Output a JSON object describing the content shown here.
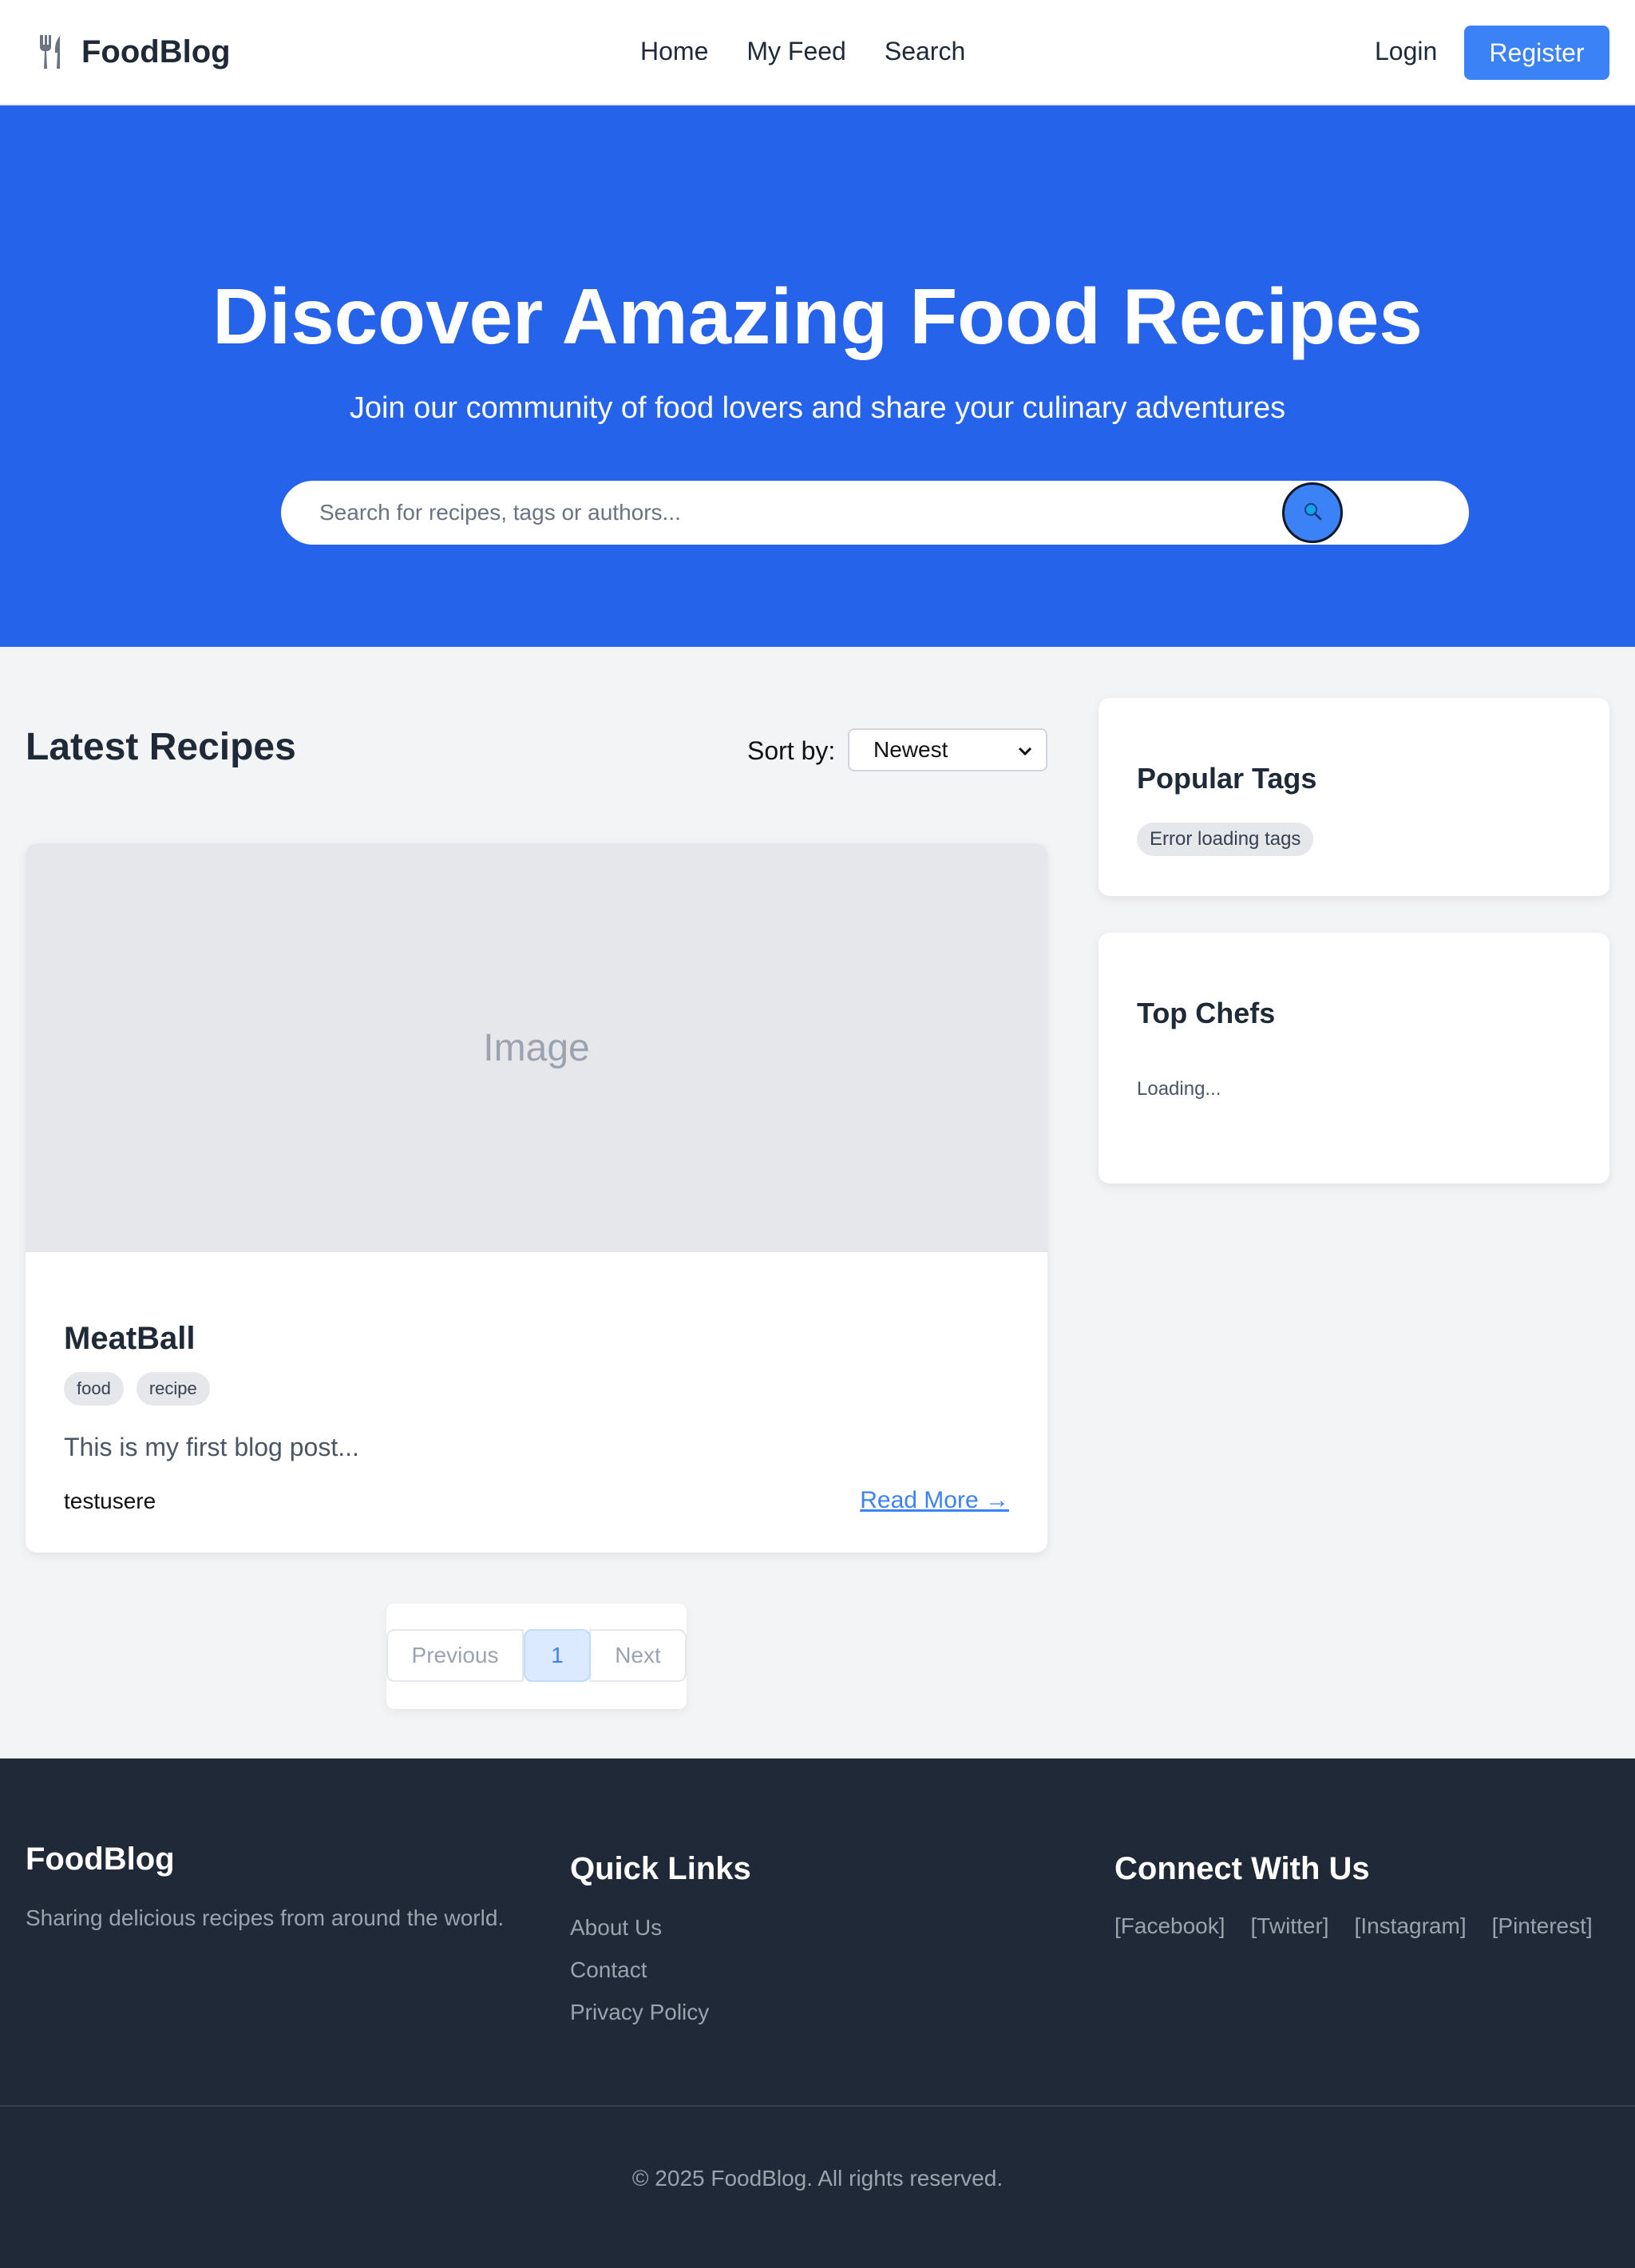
{
  "navbar": {
    "brand": "FoodBlog",
    "links": [
      "Home",
      "My Feed",
      "Search"
    ],
    "login": "Login",
    "register": "Register"
  },
  "hero": {
    "title": "Discover Amazing Food Recipes",
    "subtitle": "Join our community of food lovers and share your culinary adventures",
    "search_placeholder": "Search for recipes, tags or authors..."
  },
  "main": {
    "section_title": "Latest Recipes",
    "sort_label": "Sort by:",
    "sort_value": "Newest",
    "recipes": [
      {
        "image_placeholder": "Image",
        "title": "MeatBall",
        "tags": [
          "food",
          "recipe"
        ],
        "excerpt": "This is my first blog post...",
        "author": "testusere",
        "read_more": "Read More →"
      }
    ],
    "pagination": {
      "previous": "Previous",
      "current": "1",
      "next": "Next"
    }
  },
  "sidebar": {
    "popular_tags": {
      "title": "Popular Tags",
      "message": "Error loading tags"
    },
    "top_chefs": {
      "title": "Top Chefs",
      "message": "Loading..."
    }
  },
  "footer": {
    "brand": "FoodBlog",
    "tagline": "Sharing delicious recipes from around the world.",
    "quick_links_title": "Quick Links",
    "quick_links": [
      "About Us",
      "Contact",
      "Privacy Policy"
    ],
    "connect_title": "Connect With Us",
    "social": [
      "[Facebook]",
      "[Twitter]",
      "[Instagram]",
      "[Pinterest]"
    ],
    "copyright": "© 2025 FoodBlog. All rights reserved."
  },
  "colors": {
    "primary": "#2563eb",
    "accent": "#3b82f6",
    "footer_bg": "#1f2937"
  },
  "icons": [
    "fork-knife-icon",
    "search-icon",
    "chevron-down-icon"
  ]
}
